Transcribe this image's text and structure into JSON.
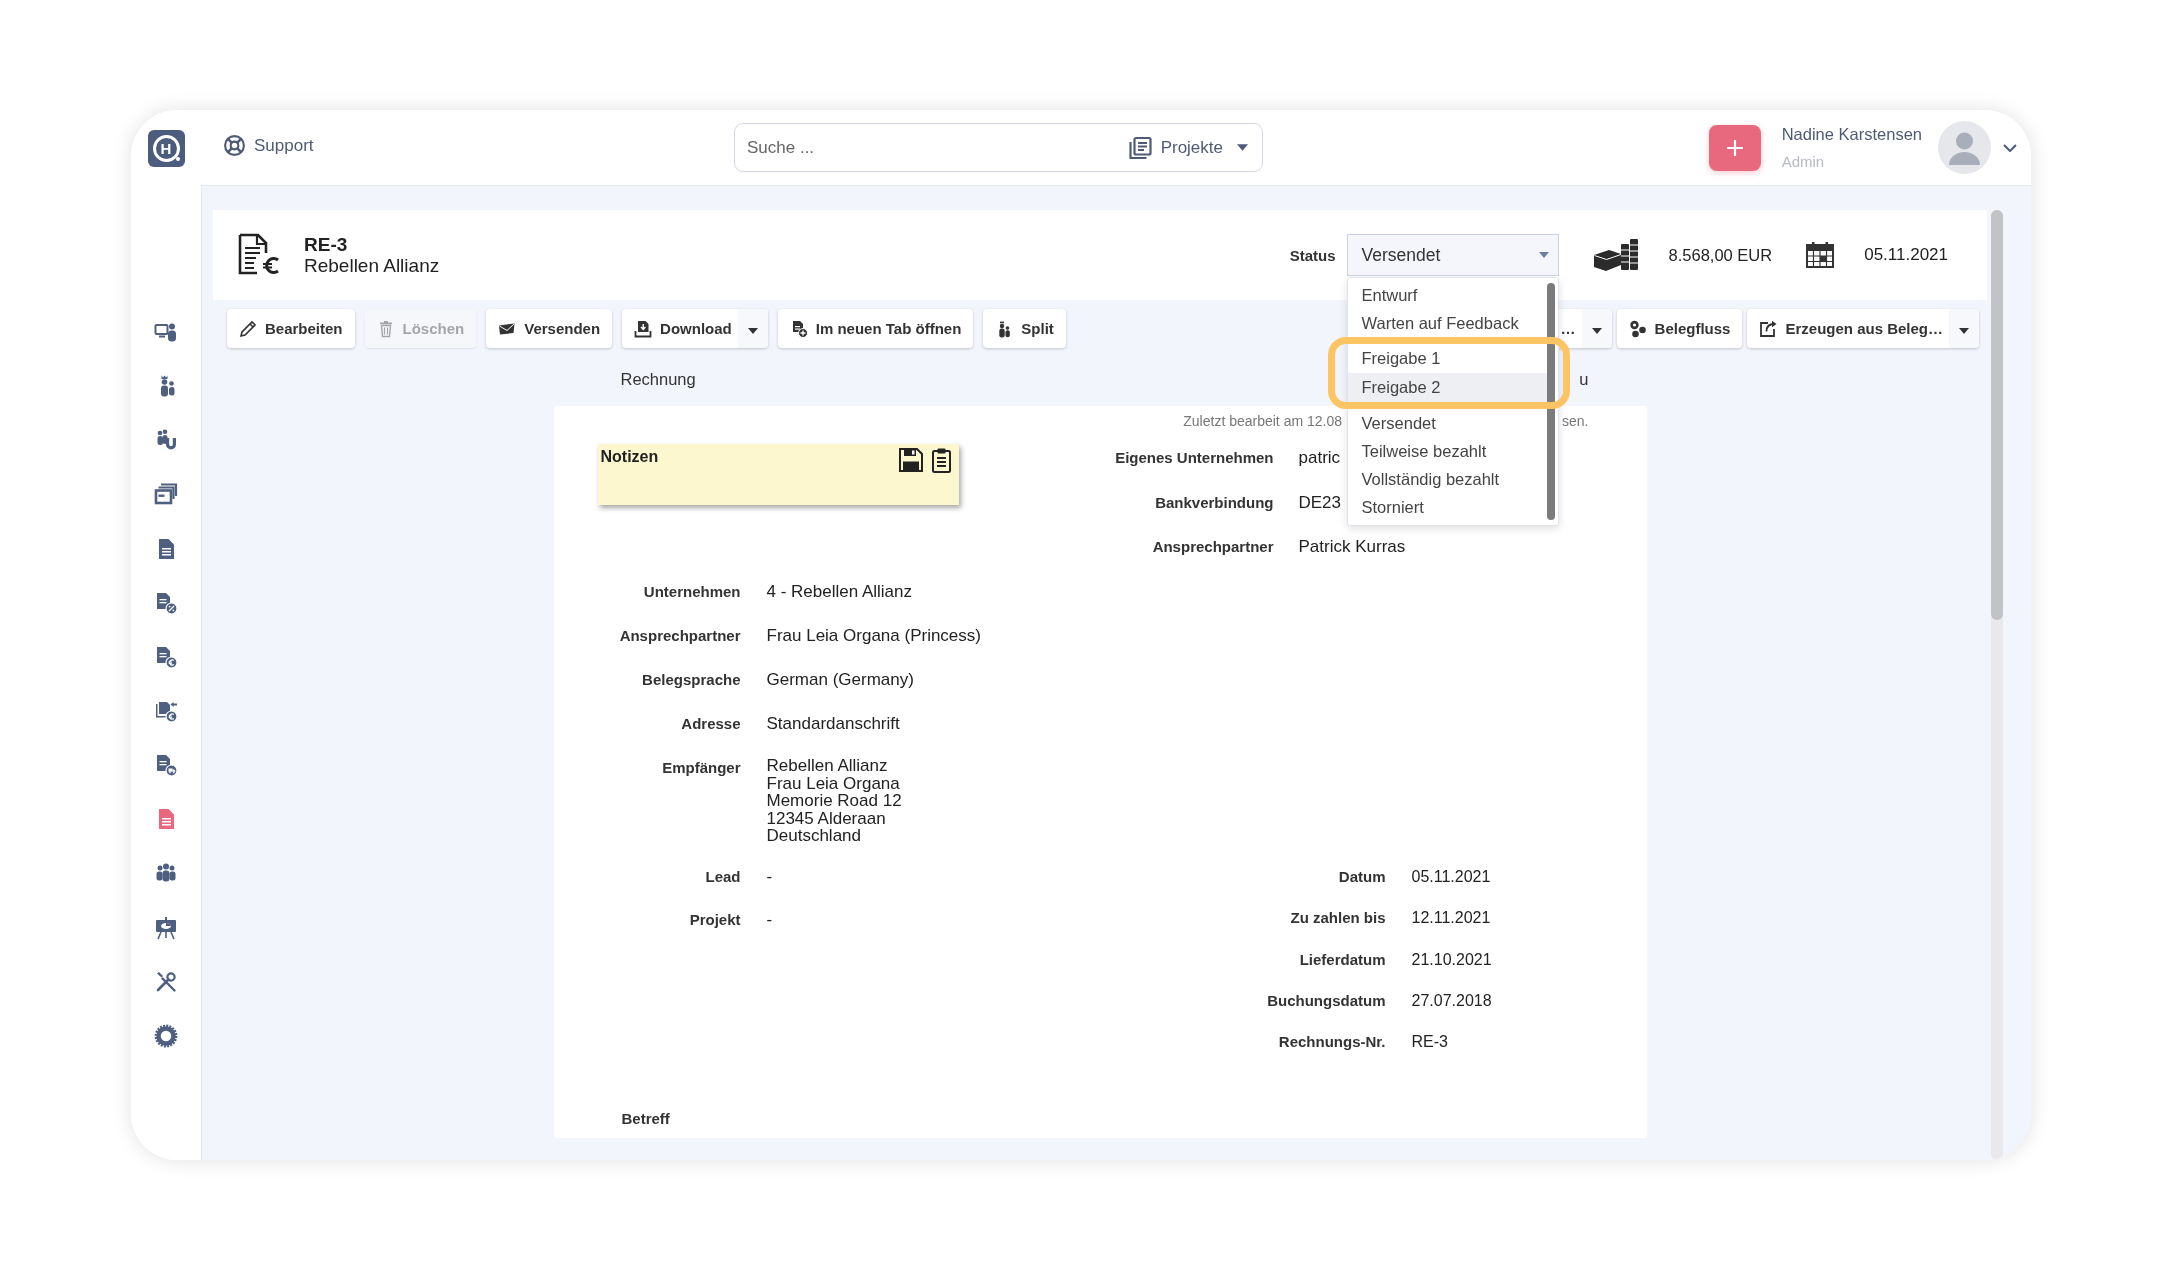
{
  "topbar": {
    "logo": "H",
    "support": "Support",
    "search": {
      "placeholder": "Suche ...",
      "scope": "Projekte"
    },
    "user": {
      "name": "Nadine Karstensen",
      "role": "Admin"
    }
  },
  "sidebar": {
    "items": [
      {
        "color": "#4e5f80"
      },
      {
        "color": "#4e5f80"
      },
      {
        "color": "#4e5f80"
      },
      {
        "color": "#4e5f80"
      },
      {
        "color": "#4e5f80"
      },
      {
        "color": "#4e5f80"
      },
      {
        "color": "#4e5f80"
      },
      {
        "color": "#4e5f80"
      },
      {
        "color": "#4e5f80"
      },
      {
        "color": "#e8697d"
      },
      {
        "color": "#4e5f80"
      },
      {
        "color": "#4e5f80"
      },
      {
        "color": "#4e5f80"
      },
      {
        "color": "#4e5f80"
      }
    ]
  },
  "header": {
    "number": "RE-3",
    "company": "Rebellen Allianz",
    "status": {
      "label": "Status",
      "value": "Versendet",
      "expanded": true,
      "options": [
        {
          "label": "Entwurf",
          "highlighted": false,
          "framed": false
        },
        {
          "label": "Warten auf Feedback",
          "highlighted": false,
          "framed": false
        },
        {
          "label": "Freigabe 1",
          "highlighted": false,
          "framed": true
        },
        {
          "label": "Freigabe 2",
          "highlighted": true,
          "framed": true
        },
        {
          "label": "Versendet",
          "highlighted": false,
          "framed": false
        },
        {
          "label": "Teilweise bezahlt",
          "highlighted": false,
          "framed": false
        },
        {
          "label": "Vollständig bezahlt",
          "highlighted": false,
          "framed": false
        },
        {
          "label": "Storniert",
          "highlighted": false,
          "framed": false
        }
      ]
    },
    "amount": "8.568,00 EUR",
    "date": "05.11.2021"
  },
  "toolbar": {
    "left": [
      {
        "label": "Bearbeiten",
        "disabled": false,
        "dropdown": false
      },
      {
        "label": "Löschen",
        "disabled": true,
        "dropdown": false
      },
      {
        "label": "Versenden",
        "disabled": false,
        "dropdown": false
      },
      {
        "label": "Download",
        "disabled": false,
        "dropdown": true
      },
      {
        "label": "Im neuen Tab öffnen",
        "disabled": false,
        "dropdown": false
      },
      {
        "label": "Split",
        "disabled": false,
        "dropdown": false
      }
    ],
    "right": [
      {
        "label": "…",
        "disabled": false,
        "dropdown": true
      },
      {
        "label": "Belegfluss",
        "disabled": false,
        "dropdown": false
      },
      {
        "label": "Erzeugen aus Beleg…",
        "disabled": false,
        "dropdown": true
      }
    ]
  },
  "captions": [
    "Rechnung",
    "u"
  ],
  "document": {
    "last_edited": {
      "start": "Zuletzt bearbeit am 12.08",
      "end": "sen."
    },
    "notes": {
      "title": "Notizen"
    },
    "company_fields": [
      {
        "label": "Eigenes Unternehmen",
        "value": "patric"
      },
      {
        "label": "Bankverbindung",
        "value": "DE23"
      },
      {
        "label": "Ansprechpartner",
        "value": "Patrick Kurras"
      }
    ],
    "customer_fields": [
      {
        "kind": "text",
        "label": "Unternehmen",
        "value": "4 - Rebellen Allianz"
      },
      {
        "kind": "text",
        "label": "Ansprechpartner",
        "value": "Frau Leia Organa (Princess)"
      },
      {
        "kind": "text",
        "label": "Belegsprache",
        "value": "German (Germany)"
      },
      {
        "kind": "text",
        "label": "Adresse",
        "value": "Standardanschrift"
      },
      {
        "kind": "address",
        "label": "Empfänger",
        "lines": [
          "Rebellen Allianz",
          "Frau Leia Organa",
          "Memorie Road 12",
          "12345 Alderaan",
          "Deutschland"
        ]
      }
    ],
    "link_fields": [
      {
        "label": "Lead",
        "value": "-"
      },
      {
        "label": "Projekt",
        "value": "-"
      }
    ],
    "date_fields": [
      {
        "label": "Datum",
        "value": "05.11.2021"
      },
      {
        "label": "Zu zahlen bis",
        "value": "12.11.2021"
      },
      {
        "label": "Lieferdatum",
        "value": "21.10.2021"
      },
      {
        "label": "Buchungsdatum",
        "value": "27.07.2018"
      },
      {
        "label": "Rechnungs-Nr.",
        "value": "RE-3"
      }
    ],
    "subject_label": "Betreff"
  }
}
